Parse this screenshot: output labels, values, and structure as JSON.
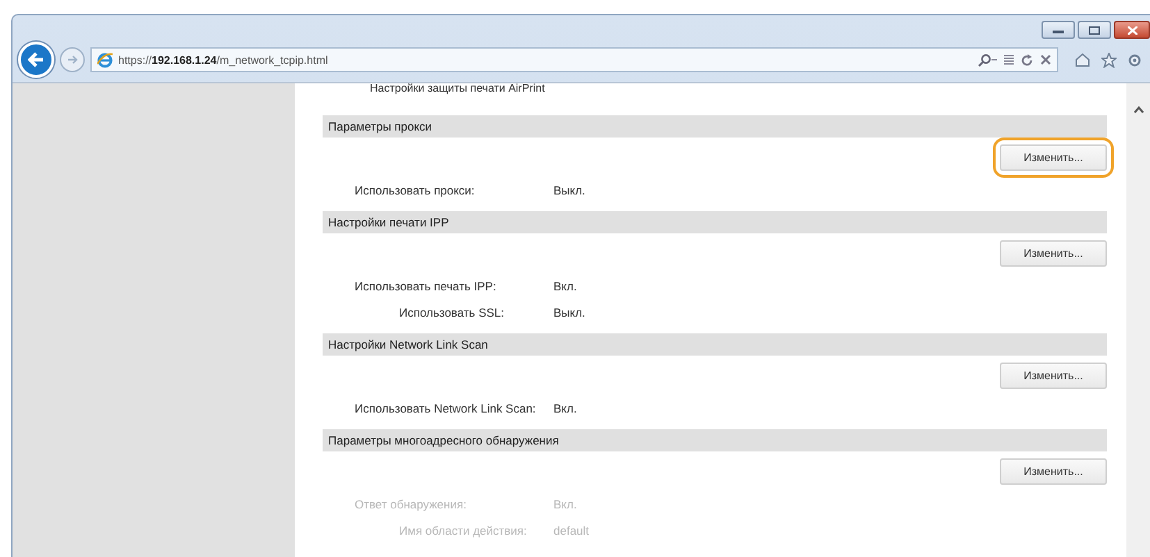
{
  "browser": {
    "address": "https://**192.168.1.24**/m_network_tcpip.html"
  },
  "cut_text": "Настройки защиты печати AirPrint",
  "sections": [
    {
      "title": "Параметры прокси",
      "button": {
        "label": "Изменить...",
        "highlighted": true
      },
      "rows": [
        {
          "label": "Использовать прокси:",
          "value": "Выкл.",
          "dimmed": false
        }
      ]
    },
    {
      "title": "Настройки печати IPP",
      "button": {
        "label": "Изменить...",
        "highlighted": false
      },
      "rows": [
        {
          "label": "Использовать печать IPP:",
          "value": "Вкл.",
          "dimmed": false,
          "children": [
            {
              "label": "Использовать SSL:",
              "value": "Выкл.",
              "dimmed": false
            }
          ]
        }
      ]
    },
    {
      "title": "Настройки Network Link Scan",
      "button": {
        "label": "Изменить...",
        "highlighted": false
      },
      "rows": [
        {
          "label": "Использовать Network Link Scan:",
          "value": "Вкл.",
          "dimmed": false
        }
      ]
    },
    {
      "title": "Параметры многоадресного обнаружения",
      "button": {
        "label": "Изменить...",
        "highlighted": false
      },
      "rows": [
        {
          "label": "Ответ обнаружения:",
          "value": "Вкл.",
          "dimmed": true,
          "children": [
            {
              "label": "Имя области действия:",
              "value": "default",
              "dimmed": true
            }
          ]
        }
      ]
    }
  ]
}
